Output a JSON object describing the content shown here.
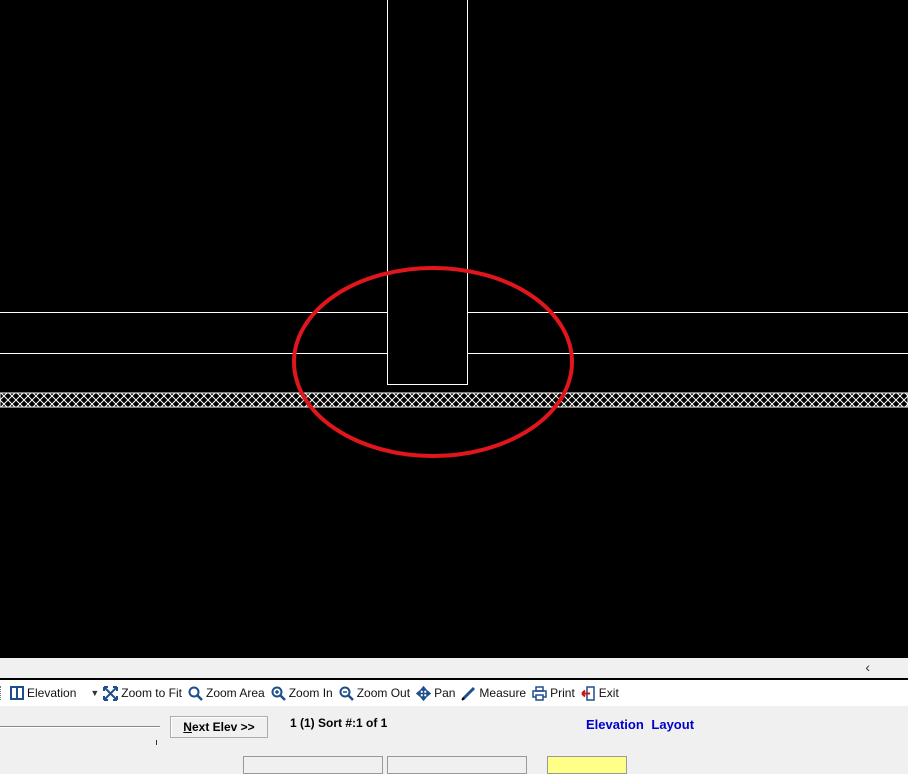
{
  "toolbar": {
    "items": [
      {
        "label": "Elevation",
        "icon": "elevation-icon"
      },
      {
        "label": "Zoom to Fit",
        "icon": "zoom-to-fit-icon"
      },
      {
        "label": "Zoom Area",
        "icon": "zoom-area-icon"
      },
      {
        "label": "Zoom In",
        "icon": "zoom-in-icon"
      },
      {
        "label": "Zoom Out",
        "icon": "zoom-out-icon"
      },
      {
        "label": "Pan",
        "icon": "pan-icon"
      },
      {
        "label": "Measure",
        "icon": "measure-icon"
      },
      {
        "label": "Print",
        "icon": "print-icon"
      },
      {
        "label": "Exit",
        "icon": "exit-icon"
      }
    ]
  },
  "nav": {
    "next_label_first": "N",
    "next_label_rest": "ext Elev >>",
    "sort_info": "1 (1) Sort #:1  of 1",
    "title": "Elevation  Layout"
  },
  "colors": {
    "canvas_bg": "#000000",
    "drawing_lines": "#ffffff",
    "highlight_circle": "#e0161c",
    "title_blue": "#0000cc",
    "button_yellow": "#ffff88"
  }
}
